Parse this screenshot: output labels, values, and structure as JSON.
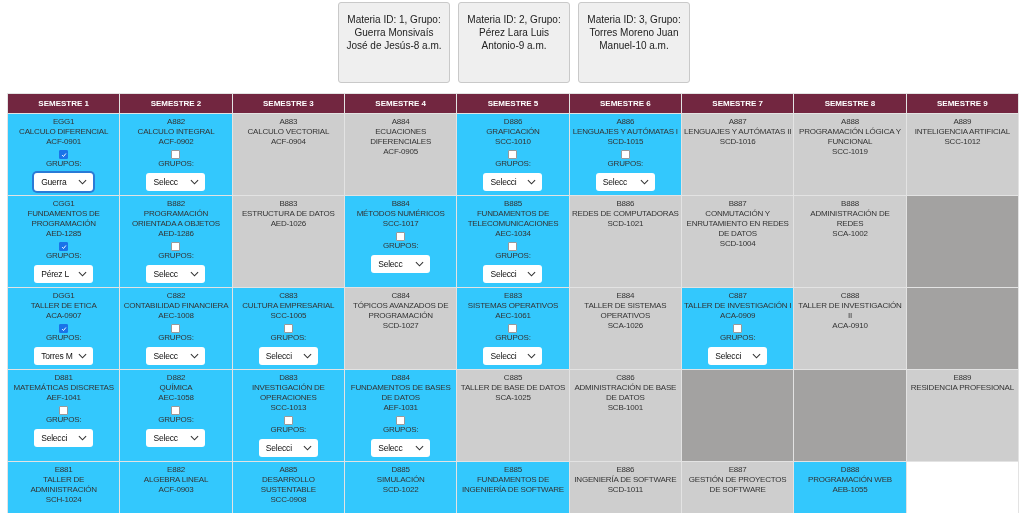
{
  "group_cards": [
    "Materia ID: 1, Grupo: Guerra Monsivaís José de Jesús-8 a.m.",
    "Materia ID: 2, Grupo: Pérez Lara Luis Antonio-9 a.m.",
    "Materia ID: 3, Grupo: Torres Moreno Juan Manuel-10 a.m."
  ],
  "table": {
    "columns": [
      "SEMESTRE 1",
      "SEMESTRE 2",
      "SEMESTRE 3",
      "SEMESTRE 4",
      "SEMESTRE 5",
      "SEMESTRE 6",
      "SEMESTRE 7",
      "SEMESTRE 8",
      "SEMESTRE 9"
    ],
    "rows": [
      [
        {
          "kind": "open",
          "code": "EGG1",
          "name": "CALCULO DIFERENCIAL",
          "key": "ACF-0901",
          "checked": true,
          "groups_label": "GRUPOS:",
          "select": "Guerra"
        },
        {
          "kind": "open",
          "code": "A882",
          "name": "CALCULO INTEGRAL",
          "key": "ACF-0902",
          "checked": false,
          "groups_label": "GRUPOS:",
          "select": "Selecc"
        },
        {
          "kind": "closed",
          "code": "A883",
          "name": "CALCULO VECTORIAL",
          "key": "ACF-0904"
        },
        {
          "kind": "closed",
          "code": "A884",
          "name": "ECUACIONES DIFERENCIALES",
          "key": "ACF-0905"
        },
        {
          "kind": "open",
          "code": "D886",
          "name": "GRAFICACIÓN",
          "key": "SCC-1010",
          "checked": false,
          "groups_label": "GRUPOS:",
          "select": "Selecci"
        },
        {
          "kind": "open",
          "code": "A886",
          "name": "LENGUAJES Y AUTÓMATAS I",
          "key": "SCD-1015",
          "checked": false,
          "groups_label": "GRUPOS:",
          "select": "Selecc"
        },
        {
          "kind": "closed",
          "code": "A887",
          "name": "LENGUAJES Y AUTÓMATAS II",
          "key": "SCD-1016"
        },
        {
          "kind": "closed",
          "code": "A888",
          "name": "PROGRAMACIÓN LÓGICA Y FUNCIONAL",
          "key": "SCC-1019"
        },
        {
          "kind": "closed",
          "code": "A889",
          "name": "INTELIGENCIA ARTIFICIAL",
          "key": "SCC-1012"
        }
      ],
      [
        {
          "kind": "open",
          "code": "CGG1",
          "name": "FUNDAMENTOS DE PROGRAMACIÓN",
          "key": "AED-1285",
          "checked": true,
          "groups_label": "GRUPOS:",
          "select": "Pérez L"
        },
        {
          "kind": "open",
          "code": "B882",
          "name": "PROGRAMACIÓN ORIENTADA A OBJETOS",
          "key": "AED-1286",
          "checked": false,
          "groups_label": "GRUPOS:",
          "select": "Selecc"
        },
        {
          "kind": "closed",
          "code": "B883",
          "name": "ESTRUCTURA DE DATOS",
          "key": "AED-1026"
        },
        {
          "kind": "open",
          "code": "B884",
          "name": "MÉTODOS NUMÉRICOS",
          "key": "SCC-1017",
          "checked": false,
          "groups_label": "GRUPOS:",
          "select": "Selecc"
        },
        {
          "kind": "open",
          "code": "B885",
          "name": "FUNDAMENTOS DE TELECOMUNICACIONES",
          "key": "AEC-1034",
          "checked": false,
          "groups_label": "GRUPOS:",
          "select": "Selecci"
        },
        {
          "kind": "closed",
          "code": "B886",
          "name": "REDES DE COMPUTADORAS",
          "key": "SCD-1021"
        },
        {
          "kind": "closed",
          "code": "B887",
          "name": "CONMUTACIÓN Y ENRUTAMIENTO EN REDES DE DATOS",
          "key": "SCD-1004"
        },
        {
          "kind": "closed",
          "code": "B888",
          "name": "ADMINISTRACIÓN DE REDES",
          "key": "SCA-1002"
        },
        {
          "kind": "empty"
        }
      ],
      [
        {
          "kind": "open",
          "code": "DGG1",
          "name": "TALLER DE ETICA",
          "key": "ACA-0907",
          "checked": true,
          "groups_label": "GRUPOS:",
          "select": "Torres M"
        },
        {
          "kind": "open",
          "code": "C882",
          "name": "CONTABILIDAD FINANCIERA",
          "key": "AEC-1008",
          "checked": false,
          "groups_label": "GRUPOS:",
          "select": "Selecc"
        },
        {
          "kind": "open",
          "code": "C883",
          "name": "CULTURA EMPRESARIAL",
          "key": "SCC-1005",
          "checked": false,
          "groups_label": "GRUPOS:",
          "select": "Selecci"
        },
        {
          "kind": "closed",
          "code": "C884",
          "name": "TÓPICOS AVANZADOS DE PROGRAMACIÓN",
          "key": "SCD-1027"
        },
        {
          "kind": "open",
          "code": "E883",
          "name": "SISTEMAS OPERATIVOS",
          "key": "AEC-1061",
          "checked": false,
          "groups_label": "GRUPOS:",
          "select": "Selecci"
        },
        {
          "kind": "closed",
          "code": "E884",
          "name": "TALLER DE SISTEMAS OPERATIVOS",
          "key": "SCA-1026"
        },
        {
          "kind": "open",
          "code": "C887",
          "name": "TALLER DE INVESTIGACIÓN I",
          "key": "ACA-0909",
          "checked": false,
          "groups_label": "GRUPOS:",
          "select": "Selecci"
        },
        {
          "kind": "closed",
          "code": "C888",
          "name": "TALLER DE INVESTIGACIÓN II",
          "key": "ACA-0910"
        },
        {
          "kind": "empty"
        }
      ],
      [
        {
          "kind": "open",
          "code": "D881",
          "name": "MATEMÁTICAS DISCRETAS",
          "key": "AEF-1041",
          "checked": false,
          "groups_label": "GRUPOS:",
          "select": "Selecci"
        },
        {
          "kind": "open",
          "code": "D882",
          "name": "QUÍMICA",
          "key": "AEC-1058",
          "checked": false,
          "groups_label": "GRUPOS:",
          "select": "Selecc"
        },
        {
          "kind": "open",
          "code": "D883",
          "name": "INVESTIGACIÓN DE OPERACIONES",
          "key": "SCC-1013",
          "checked": false,
          "groups_label": "GRUPOS:",
          "select": "Selecci"
        },
        {
          "kind": "open",
          "code": "D884",
          "name": "FUNDAMENTOS DE BASES DE DATOS",
          "key": "AEF-1031",
          "checked": false,
          "groups_label": "GRUPOS:",
          "select": "Selecc"
        },
        {
          "kind": "closed",
          "code": "C885",
          "name": "TALLER DE BASE DE DATOS",
          "key": "SCA-1025"
        },
        {
          "kind": "closed",
          "code": "C886",
          "name": "ADMINISTRACIÓN DE BASE DE DATOS",
          "key": "SCB-1001"
        },
        {
          "kind": "empty"
        },
        {
          "kind": "empty"
        },
        {
          "kind": "closed",
          "code": "E889",
          "name": "RESIDENCIA PROFESIONAL"
        }
      ],
      [
        {
          "kind": "open",
          "code": "E881",
          "name": "TALLER DE ADMINISTRACIÓN",
          "key": "SCH-1024"
        },
        {
          "kind": "open",
          "code": "E882",
          "name": "ALGEBRA LINEAL",
          "key": "ACF-0903"
        },
        {
          "kind": "open",
          "code": "A885",
          "name": "DESARROLLO SUSTENTABLE",
          "key": "SCC-0908"
        },
        {
          "kind": "open",
          "code": "D885",
          "name": "SIMULACIÓN",
          "key": "SCD-1022"
        },
        {
          "kind": "open",
          "code": "E885",
          "name": "FUNDAMENTOS DE INGENIERÍA DE SOFTWARE"
        },
        {
          "kind": "closed",
          "code": "E886",
          "name": "INGENIERÍA DE SOFTWARE",
          "key": "SCD-1011"
        },
        {
          "kind": "closed",
          "code": "E887",
          "name": "GESTIÓN DE PROYECTOS DE SOFTWARE"
        },
        {
          "kind": "open",
          "code": "D888",
          "name": "PROGRAMACIÓN WEB",
          "key": "AEB-1055"
        },
        {
          "kind": "blank"
        }
      ]
    ]
  }
}
